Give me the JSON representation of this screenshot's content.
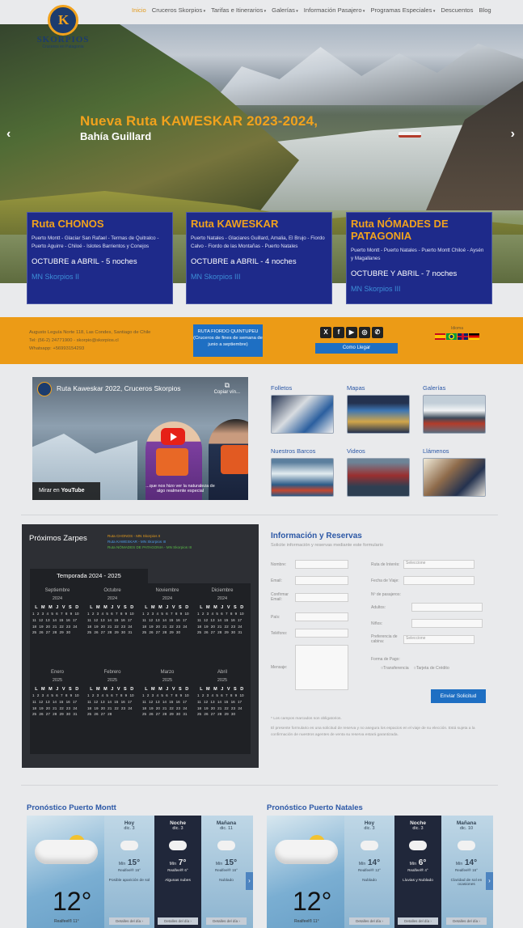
{
  "nav": {
    "items": [
      "Inicio",
      "Cruceros Skorpios",
      "Tarifas e Itinerarios",
      "Galerías",
      "Información Pasajero",
      "Programas Especiales",
      "Descuentos",
      "Blog"
    ],
    "dropdown": [
      false,
      true,
      true,
      true,
      true,
      true,
      false,
      false
    ]
  },
  "logo": {
    "name": "SKORPIOS",
    "tagline": "Cruceros en Patagonia"
  },
  "hero": {
    "title": "Nueva Ruta KAWESKAR 2023-2024,",
    "subtitle": "Bahía Guillard",
    "prev": "‹",
    "next": "›"
  },
  "routes": [
    {
      "title": "Ruta CHONOS",
      "route": "Puerto Montt - Glaciar San Rafael - Termas de Quitralco - Puerto Aguirre - Chiloé - Islotes Barrientos y Conejos",
      "season": "OCTUBRE a ABRIL - 5 noches",
      "ship": "MN Skorpios II"
    },
    {
      "title": "Ruta KAWESKAR",
      "route": "Puerto Natales - Glaciares Guillard, Amalia, El Brujo - Fiordo Calvo - Fiordo de las Montañas - Puerto Natales",
      "season": "OCTUBRE a ABRIL - 4 noches",
      "ship": "MN Skorpios III"
    },
    {
      "title": "Ruta NÓMADES DE PATAGONIA",
      "route": "Puerto Montt - Puerto Natales - Puerto Montt Chiloé - Aysén y Magallanes",
      "season": "OCTUBRE Y ABRIL - 7 noches",
      "ship": "MN Skorpios III"
    }
  ],
  "infobar": {
    "address": "Augusto Leguía Norte 118, Las Condes, Santiago de Chile",
    "phone": "Tel: (56-2) 24771900 - skorpio@skorpios.cl",
    "whatsapp": "Whatsapp: +56993154293",
    "fiord_box": "RUTA FIORDO QUINTUPEU (Cruceros de fines de semana de junio a septiembre)",
    "social": [
      "X",
      "f",
      "▶",
      "◎",
      "✆"
    ],
    "directions": "Como Llegar",
    "language_label": "Idioma"
  },
  "video": {
    "title": "Ruta Kaweskar 2022, Cruceros Skorpios",
    "copy": "Copiar vín...",
    "watch": "Mirar en",
    "yt": "YouTube",
    "caption": "...que nos hizo ver la naturaleza de algo realmente especial"
  },
  "thumbs": [
    "Folletos",
    "Mapas",
    "Galerías",
    "Nuestros Barcos",
    "Videos",
    "Llámenos"
  ],
  "calendar": {
    "title": "Próximos Zarpes",
    "legend": [
      "Ruta CHONOS - MN Skorpios II",
      "Ruta KAWESKAR - MN Skorpios III",
      "Ruta NÓMADES DE PATAGONIA - MN Skorpios III"
    ],
    "season": "Temporada 2024 - 2025",
    "weekdays": "L M M J V S D",
    "months": [
      {
        "m": "Septiembre",
        "y": "2024",
        "d": "1 2 3 4 5 6 7 8 9 10 11 12 13 14 15 16 17 18 19 20 21 22 23 24 25 26 27 28 29 30"
      },
      {
        "m": "Octubre",
        "y": "2024",
        "d": "1 2 3 4 5 6 7 8 9 10 11 12 13 14 15 16 17 18 19 20 21 22 23 24 25 26 27 28 29 30 31"
      },
      {
        "m": "Noviembre",
        "y": "2024",
        "d": "1 2 3 4 5 6 7 8 9 10 11 12 13 14 15 16 17 18 19 20 21 22 23 24 25 26 27 28 29 30"
      },
      {
        "m": "Diciembre",
        "y": "2024",
        "d": "1 2 3 4 5 6 7 8 9 10 11 12 13 14 15 16 17 18 19 20 21 22 23 24 25 26 27 28 29 30 31"
      },
      {
        "m": "Enero",
        "y": "2025",
        "d": "1 2 3 4 5 6 7 8 9 10 11 12 13 14 15 16 17 18 19 20 21 22 23 24 25 26 27 28 29 30 31"
      },
      {
        "m": "Febrero",
        "y": "2025",
        "d": "1 2 3 4 5 6 7 8 9 10 11 12 13 14 15 16 17 18 19 20 21 22 23 24 25 26 27 28"
      },
      {
        "m": "Marzo",
        "y": "2025",
        "d": "1 2 3 4 5 6 7 8 9 10 11 12 13 14 15 16 17 18 19 20 21 22 23 24 25 26 27 28 29 30 31"
      },
      {
        "m": "Abril",
        "y": "2025",
        "d": "1 2 3 4 5 6 7 8 9 10 11 12 13 14 15 16 17 18 19 20 21 22 23 24 25 26 27 28 29 30"
      }
    ]
  },
  "form": {
    "title": "Información y Reservas",
    "subtitle": "Solicite información y reservas mediante este formulario",
    "left_labels": [
      "Nombre:",
      "Email:",
      "Confirmar Email:",
      "País:",
      "Teléfono:",
      "Mensaje:"
    ],
    "right_labels": [
      "Ruta de Interés:",
      "Fecha de Viaje:",
      "Nº de pasajeros:",
      "Adultos:",
      "Niños:",
      "Preferencia de cabina:",
      "Forma de Pago:"
    ],
    "route_select": "Seleccione",
    "cabin_select": "Seleccione",
    "pay1": "Transferencia",
    "pay2": "Tarjeta de Crédito",
    "send": "Enviar Solicitud",
    "required": "* Los campos marcados son obligatorios.",
    "note": "El presente formulario es una solicitud de reserva y no asegura los espacios en el viaje de su elección. Está sujeta a la confirmación de nuestros agentes de venta su reserva estará garantizada."
  },
  "weather": [
    {
      "title": "Pronóstico Puerto Montt",
      "now": "12°",
      "feels": "Realfeel® 11°",
      "days": [
        {
          "d": "Hoy",
          "n": "dic. 3",
          "t": "15°",
          "s": "Realfeel® 16°",
          "desc": "Posible aparición de sol",
          "dark": false
        },
        {
          "d": "Noche",
          "n": "dic. 3",
          "t": "7°",
          "s": "Realfeel® 6°",
          "desc": "Algunas nubes",
          "dark": true
        },
        {
          "d": "Mañana",
          "n": "dic. 11",
          "t": "15°",
          "s": "Realfeel® 16°",
          "desc": "Nublado",
          "dark": false
        }
      ]
    },
    {
      "title": "Pronóstico Puerto Natales",
      "now": "12°",
      "feels": "Realfeel® 11°",
      "days": [
        {
          "d": "Hoy",
          "n": "dic. 3",
          "t": "14°",
          "s": "Realfeel® 12°",
          "desc": "Nublado",
          "dark": false
        },
        {
          "d": "Noche",
          "n": "dic. 3",
          "t": "6°",
          "s": "Realfeel® 4°",
          "desc": "Lluvias y Nublado",
          "dark": true
        },
        {
          "d": "Mañana",
          "n": "dic. 10",
          "t": "14°",
          "s": "Realfeel® 16°",
          "desc": "Claridad de sol en ocasiones",
          "dark": false
        }
      ]
    }
  ],
  "weather_details": "Detalles del día ›",
  "weather_min_prefix": "Mín",
  "colors": {
    "accent": "#f1a21d",
    "navy": "#1e2a8a",
    "blue": "#1e6fc3",
    "orange_bar": "#ec9b16"
  }
}
